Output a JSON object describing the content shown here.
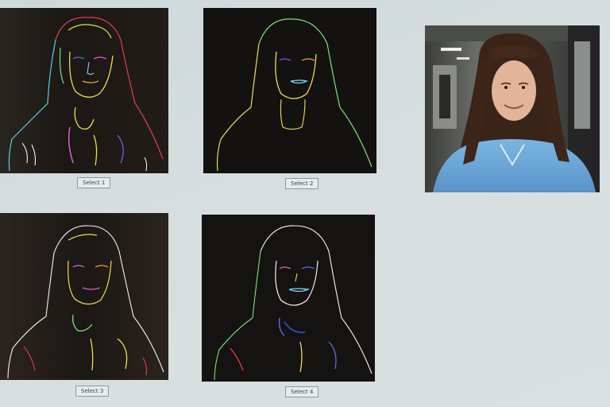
{
  "panels": [
    {
      "id": "1",
      "select_label": "Select 1"
    },
    {
      "id": "2",
      "select_label": "Select 2"
    },
    {
      "id": "3",
      "select_label": "Select 3"
    },
    {
      "id": "4",
      "select_label": "Select 4"
    }
  ],
  "photo": {
    "subject": "portrait-photo"
  },
  "colors": {
    "screen_background": "#d6dedf",
    "panel_background": "#141210",
    "edge_yellow": "#e8e24a",
    "edge_green": "#7fe07a",
    "edge_cyan": "#7fd6e8",
    "edge_magenta": "#e060d0",
    "edge_white": "#f2f2f2",
    "edge_orange": "#f0a040",
    "edge_purple": "#7060e0",
    "hoodie_blue": "#6aa8d8",
    "hair_brown": "#3a2418"
  }
}
